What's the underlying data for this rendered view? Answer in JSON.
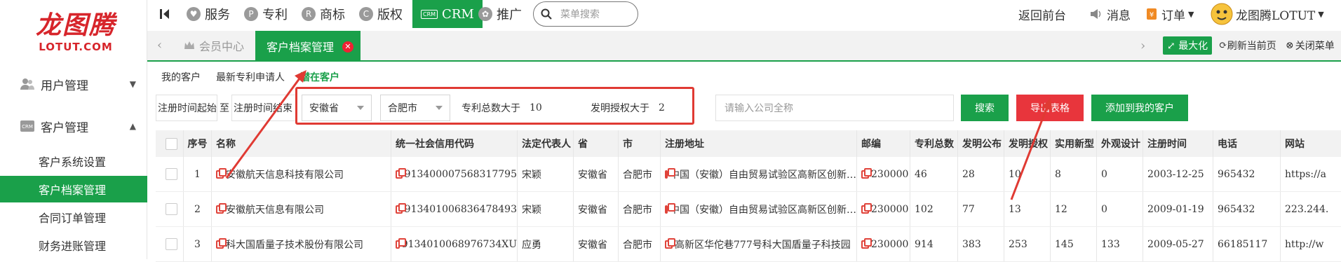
{
  "brand": {
    "logo_cn": "龙图腾",
    "logo_en": "LOTUT.COM"
  },
  "sidebar": {
    "groups": [
      {
        "label": "用户管理",
        "icon": "users-icon",
        "expanded": false
      },
      {
        "label": "客户管理",
        "icon": "crm-icon",
        "expanded": true
      }
    ],
    "items": [
      {
        "label": "客户系统设置",
        "active": false
      },
      {
        "label": "客户档案管理",
        "active": true
      },
      {
        "label": "合同订单管理",
        "active": false
      },
      {
        "label": "财务进账管理",
        "active": false
      }
    ]
  },
  "topnav": {
    "items": [
      {
        "label": "服务",
        "icon": "service-icon",
        "glyph": "♥"
      },
      {
        "label": "专利",
        "icon": "patent-icon",
        "glyph": "P"
      },
      {
        "label": "商标",
        "icon": "trademark-icon",
        "glyph": "R"
      },
      {
        "label": "版权",
        "icon": "copyright-icon",
        "glyph": "C"
      },
      {
        "label": "CRM",
        "icon": "crm-icon",
        "glyph": "CRM"
      },
      {
        "label": "推广",
        "icon": "promote-icon",
        "glyph": "✿"
      }
    ],
    "search_placeholder": "菜单搜索",
    "back": "返回前台",
    "messages": "消息",
    "orders": "订单",
    "user": "龙图腾LOTUT"
  },
  "tabbar": {
    "home": "会员中心",
    "active": "客户档案管理",
    "maximize": "最大化",
    "refresh": "刷新当前页",
    "close": "关闭菜单"
  },
  "subtabs": [
    "我的客户",
    "最新专利申请人",
    "潜在客户"
  ],
  "filters": {
    "reg_start": "注册时间起始",
    "to": "至",
    "reg_end": "注册时间结束",
    "province": "安徽省",
    "city": "合肥市",
    "patent_total_label": "专利总数大于",
    "patent_total_value": "10",
    "invention_label": "发明授权大于",
    "invention_value": "2",
    "company_placeholder": "请输入公司全称",
    "search_btn": "搜索",
    "export_btn": "导出表格",
    "add_btn": "添加到我的客户"
  },
  "table": {
    "columns": [
      "序号",
      "名称",
      "统一社会信用代码",
      "法定代表人",
      "省",
      "市",
      "注册地址",
      "邮编",
      "专利总数",
      "发明公布",
      "发明授权",
      "实用新型",
      "外观设计",
      "注册时间",
      "电话",
      "网站"
    ],
    "rows": [
      [
        "1",
        "安徽航天信息科技有限公司",
        "913400007568317795",
        "宋颖",
        "安徽省",
        "合肥市",
        "中国（安徽）自由贸易试验区高新区创新…",
        "230000",
        "46",
        "28",
        "10",
        "8",
        "0",
        "2003-12-25",
        "965432",
        "https://a"
      ],
      [
        "2",
        "安徽航天信息有限公司",
        "913401006836478493",
        "宋颖",
        "安徽省",
        "合肥市",
        "中国（安徽）自由贸易试验区高新区创新…",
        "230000",
        "102",
        "77",
        "13",
        "12",
        "0",
        "2009-01-19",
        "965432",
        "223.244."
      ],
      [
        "3",
        "科大国盾量子技术股份有限公司",
        "9134010068976734XU",
        "应勇",
        "安徽省",
        "合肥市",
        "高新区华佗巷777号科大国盾量子科技园",
        "230000",
        "914",
        "383",
        "253",
        "145",
        "133",
        "2009-05-27",
        "66185117",
        "http://w"
      ]
    ]
  },
  "colors": {
    "accent": "#1aa04a",
    "danger": "#e8353c",
    "annotation": "#e03a33"
  }
}
